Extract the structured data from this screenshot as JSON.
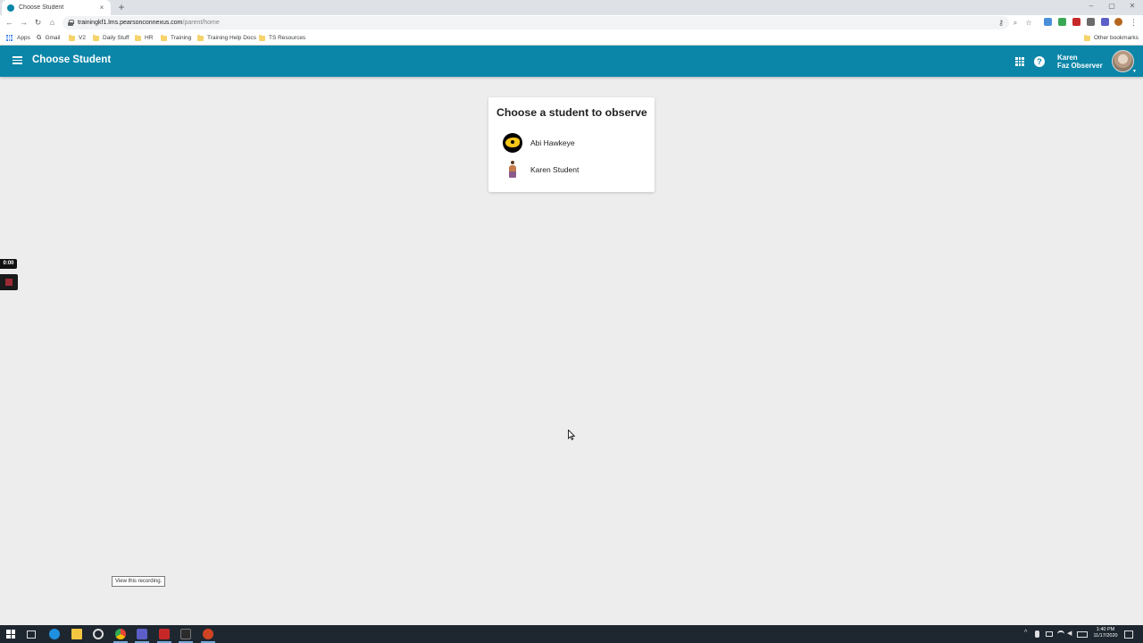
{
  "browser": {
    "tab_title": "Choose Student",
    "tab_close": "×",
    "new_tab": "+",
    "window_controls": {
      "minimize": "–",
      "maximize": "▢",
      "close": "✕"
    },
    "nav": {
      "back": "←",
      "forward": "→",
      "reload": "↻",
      "home": "⌂"
    },
    "url_host": "trainingkf1.lms.pearsonconnexus.com",
    "url_path": "/parent/home",
    "omnibox_icons": [
      "key-icon",
      "zoom-icon",
      "star-icon"
    ],
    "menu": "⋮",
    "bookmarks": [
      {
        "label": "Apps",
        "icon": "apps-icon"
      },
      {
        "label": "Gmail",
        "icon": "google-icon"
      },
      {
        "label": "V2",
        "icon": "folder-icon"
      },
      {
        "label": "Daily Stuff",
        "icon": "folder-icon"
      },
      {
        "label": "HR",
        "icon": "folder-icon"
      },
      {
        "label": "Training",
        "icon": "folder-icon"
      },
      {
        "label": "Training Help Docs",
        "icon": "folder-icon"
      },
      {
        "label": "TS Resources",
        "icon": "folder-icon"
      }
    ],
    "other_bookmarks": "Other bookmarks"
  },
  "app": {
    "title": "Choose Student",
    "brand_color": "#0b86a8",
    "help_glyph": "?",
    "user_first": "Karen",
    "user_last": "Faz Observer",
    "avatar_caret": "▼"
  },
  "card": {
    "title": "Choose a student to observe",
    "students": [
      {
        "name": "Abi Hawkeye",
        "icon": "hawkeye-avatar-icon"
      },
      {
        "name": "Karen Student",
        "icon": "figure-avatar-icon"
      }
    ]
  },
  "recorder": {
    "time": "0:00",
    "view_label": "View this recording."
  },
  "taskbar": {
    "time": "1:40 PM",
    "date": "11/17/2020",
    "tray_caret": "^"
  }
}
